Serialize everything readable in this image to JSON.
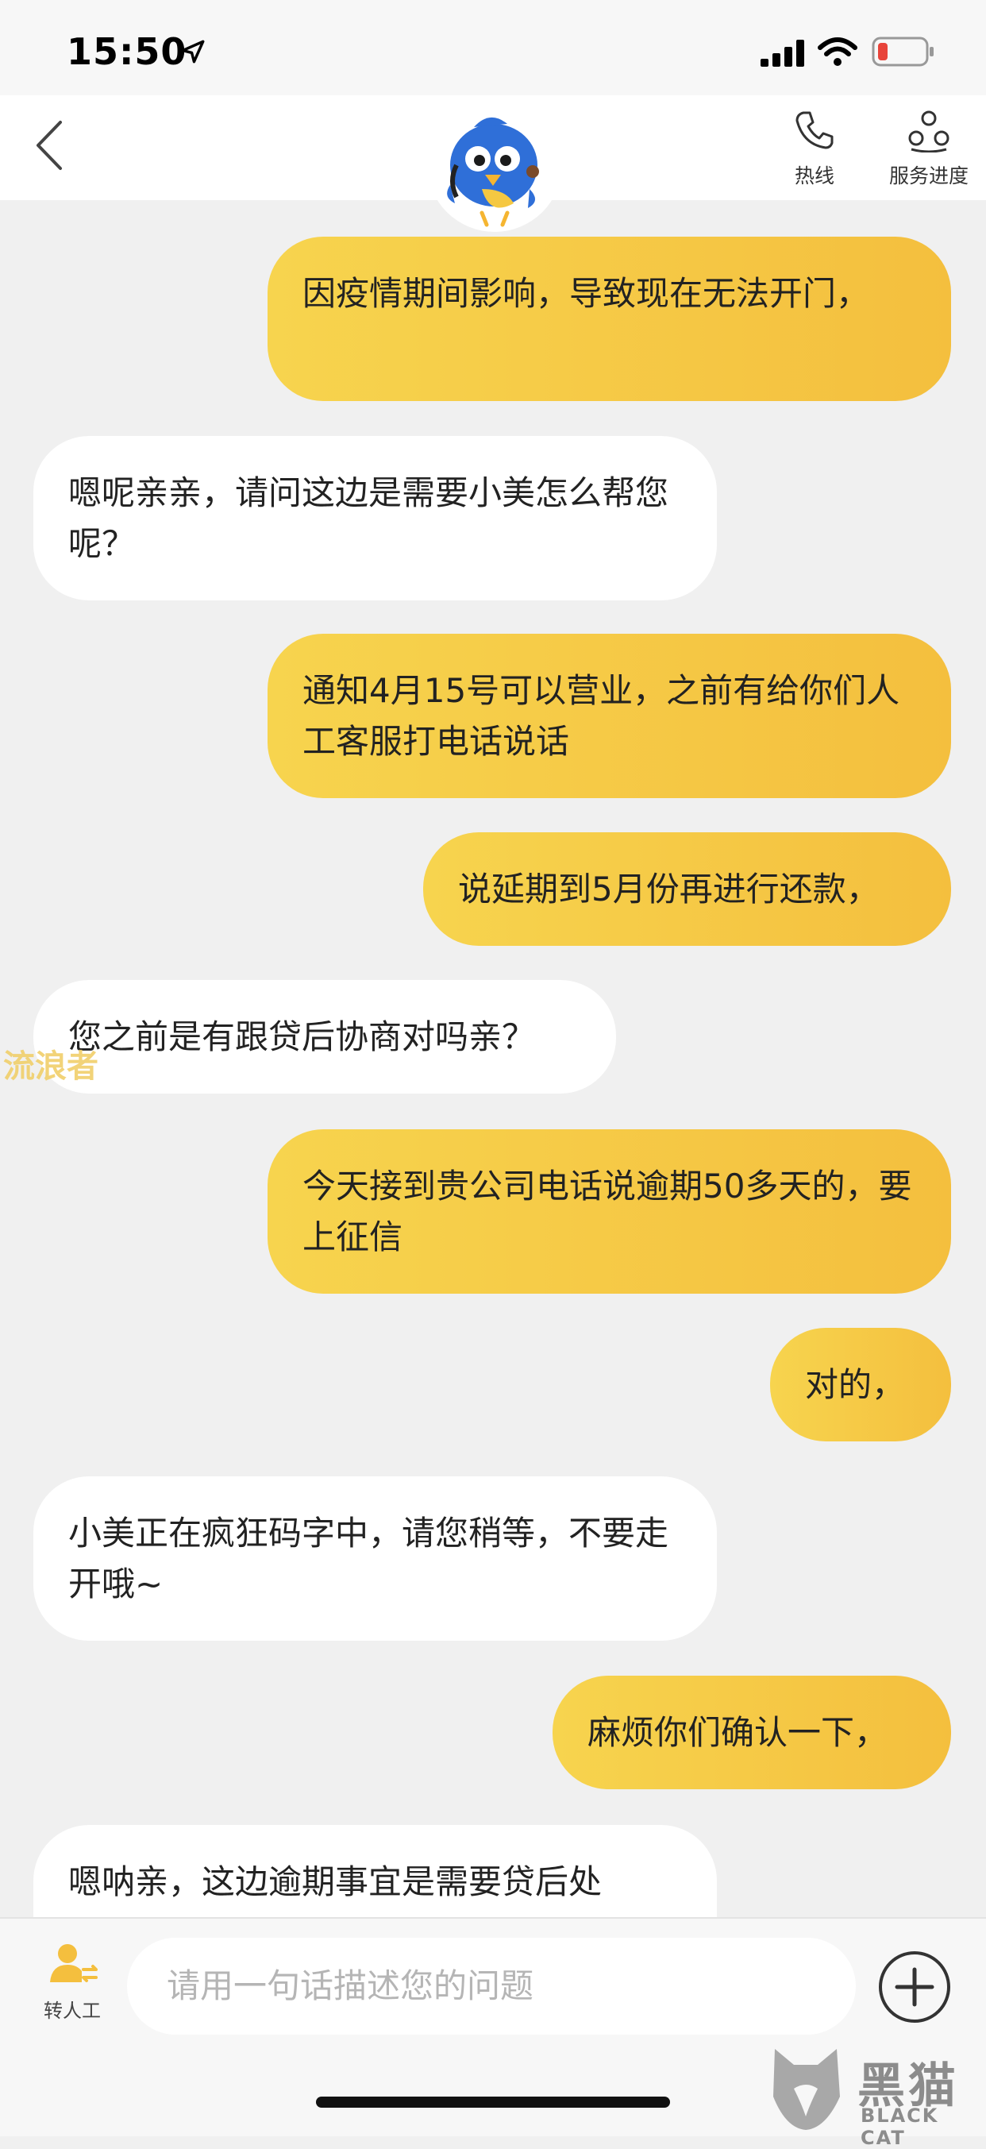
{
  "status_bar": {
    "time": "15:50",
    "battery_color": "#e8443a"
  },
  "nav": {
    "hotline_label": "热线",
    "progress_label": "服务进度",
    "mascot_icon": "blue-bird-mascot"
  },
  "messages": [
    {
      "from": "user",
      "text": "因疫情期间影响，导致现在无法开门，"
    },
    {
      "from": "agent",
      "text": "嗯呢亲亲，请问这边是需要小美怎么帮您呢？"
    },
    {
      "from": "user",
      "text": "通知4月15号可以营业，之前有给你们人工客服打电话说话"
    },
    {
      "from": "user",
      "text": "说延期到5月份再进行还款，"
    },
    {
      "from": "agent",
      "text": "您之前是有跟贷后协商对吗亲？"
    },
    {
      "from": "user",
      "text": "今天接到贵公司电话说逾期50多天的，要上征信"
    },
    {
      "from": "user",
      "text": "对的，"
    },
    {
      "from": "agent",
      "text": "小美正在疯狂码字中，请您稍等，不要走开哦~"
    },
    {
      "from": "user",
      "text": "麻烦你们确认一下，"
    },
    {
      "from": "agent",
      "text": "嗯呐亲，这边逾期事宜是需要贷后处"
    }
  ],
  "watermark": "流浪者",
  "bottom": {
    "transfer_label": "转人工",
    "input_placeholder": "请用一句话描述您的问题"
  },
  "logo": {
    "cn": "黑猫",
    "en": "BLACK CAT"
  },
  "colors": {
    "user_bubble": "#f5c842",
    "agent_bubble": "#ffffff",
    "accent": "#f4bf3e"
  }
}
